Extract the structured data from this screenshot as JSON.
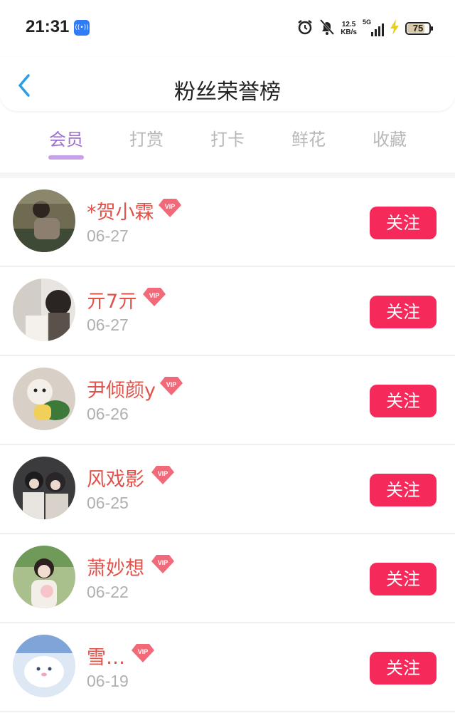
{
  "status_bar": {
    "time": "21:31",
    "hotspot": "((•))",
    "net_speed_value": "12.5",
    "net_speed_unit": "KB/s",
    "signal_label": "5G",
    "battery": "75",
    "battery_level_percent": 75,
    "icons": [
      "alarm-icon",
      "mute-bell-icon",
      "signal-icon",
      "charging-icon",
      "battery-icon"
    ]
  },
  "header": {
    "title": "粉丝荣誉榜",
    "back_icon": "chevron-left-icon"
  },
  "tabs": [
    {
      "label": "会员",
      "active": true
    },
    {
      "label": "打赏",
      "active": false
    },
    {
      "label": "打卡",
      "active": false
    },
    {
      "label": "鲜花",
      "active": false
    },
    {
      "label": "收藏",
      "active": false
    }
  ],
  "colors": {
    "accent_tab": "#9d6fd0",
    "name_color": "#e0524a",
    "follow_button": "#f5295a",
    "vip_badge": "#f06a7a"
  },
  "members": [
    {
      "name": "*贺小霖",
      "date": "06-27",
      "vip": "VIP",
      "follow": "关注"
    },
    {
      "name": "亓7亓",
      "date": "06-27",
      "vip": "VIP",
      "follow": "关注"
    },
    {
      "name": "尹倾颜y",
      "date": "06-26",
      "vip": "VIP",
      "follow": "关注"
    },
    {
      "name": "风戏影",
      "date": "06-25",
      "vip": "VIP",
      "follow": "关注"
    },
    {
      "name": "萧妙想",
      "date": "06-22",
      "vip": "VIP",
      "follow": "关注"
    },
    {
      "name": "雪…",
      "date": "06-19",
      "vip": "VIP",
      "follow": "关注"
    }
  ]
}
